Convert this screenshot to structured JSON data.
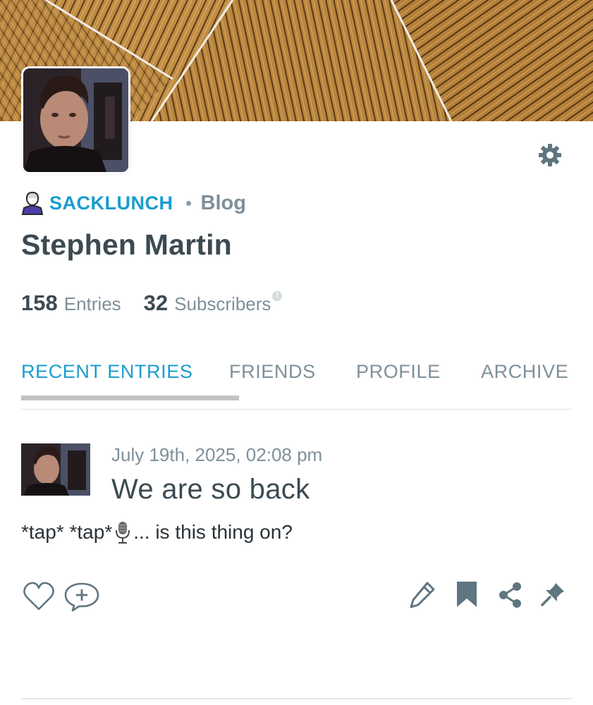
{
  "profile": {
    "community": "SACKLUNCH",
    "section": "Blog",
    "name": "Stephen Martin",
    "stats": {
      "entries_count": "158",
      "entries_label": "Entries",
      "subscribers_count": "32",
      "subscribers_label": "Subscribers",
      "info_mark": "!"
    }
  },
  "tabs": [
    {
      "label": "RECENT ENTRIES",
      "active": true
    },
    {
      "label": "FRIENDS",
      "active": false
    },
    {
      "label": "PROFILE",
      "active": false
    },
    {
      "label": "ARCHIVE",
      "active": false
    }
  ],
  "entry": {
    "date": "July 19th, 2025, 02:08 pm",
    "title": "We are so back",
    "body_before": "*tap* *tap*",
    "body_after": "... is this thing on?"
  },
  "icons": {
    "settings": "gear-icon",
    "user": "user-icon",
    "mic": "microphone-icon",
    "like": "heart-icon",
    "comment": "comment-add-icon",
    "edit": "pencil-icon",
    "bookmark": "bookmark-icon",
    "share": "share-icon",
    "pin": "pin-icon"
  },
  "colors": {
    "accent": "#1a9ccf",
    "text": "#3d4a52",
    "muted": "#7e909a",
    "icon": "#5f7580",
    "banner": "#b7863f"
  }
}
